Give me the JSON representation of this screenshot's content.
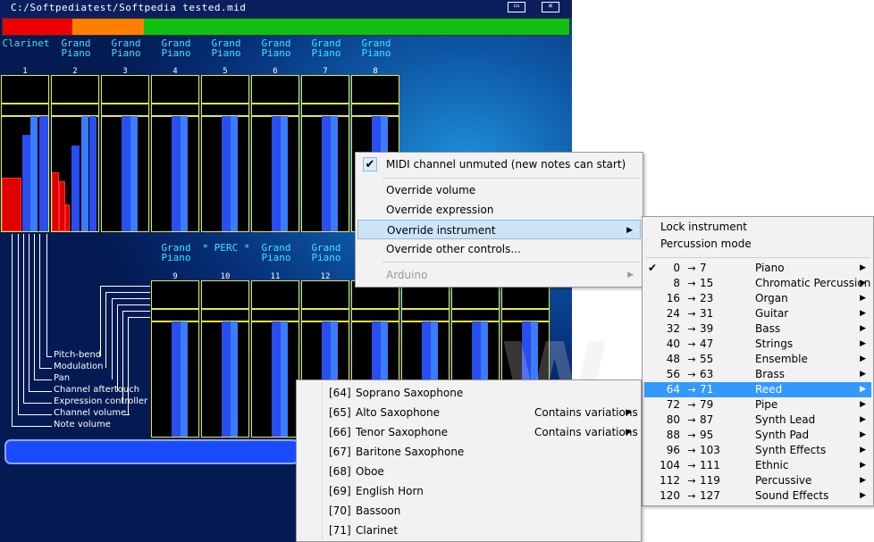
{
  "window": {
    "title": "C:/Softpediatest/Softpedia tested.mid",
    "minimize_glyph": "▭",
    "close_glyph": "✕"
  },
  "progress_colors": {
    "red": "#ee0000",
    "orange": "#ff8000",
    "green": "#10c010"
  },
  "top_instruments": [
    {
      "line1": "Clarinet",
      "line2": ""
    },
    {
      "line1": "Grand",
      "line2": "Piano"
    },
    {
      "line1": "Grand",
      "line2": "Piano"
    },
    {
      "line1": "Grand",
      "line2": "Piano"
    },
    {
      "line1": "Grand",
      "line2": "Piano"
    },
    {
      "line1": "Grand",
      "line2": "Piano"
    },
    {
      "line1": "Grand",
      "line2": "Piano"
    },
    {
      "line1": "Grand",
      "line2": "Piano"
    }
  ],
  "top_channels": [
    "1",
    "2",
    "3",
    "4",
    "5",
    "6",
    "7",
    "8"
  ],
  "bottom_instruments": [
    {
      "line1": "Grand",
      "line2": "Piano"
    },
    {
      "line1": "* PERC *",
      "line2": ""
    },
    {
      "line1": "Grand",
      "line2": "Piano"
    },
    {
      "line1": "Grand",
      "line2": "Piano"
    }
  ],
  "bottom_channels": [
    "9",
    "10",
    "11",
    "12"
  ],
  "legend": [
    "Pitch-bend",
    "Modulation",
    "Pan",
    "Channel aftertouch",
    "Expression controller",
    "Channel volume",
    "Note volume"
  ],
  "watermark": "W",
  "context_menu": {
    "unmuted": "MIDI channel unmuted (new notes can start)",
    "check_glyph": "✔",
    "override_volume": "Override volume",
    "override_expression": "Override expression",
    "override_instrument": "Override instrument",
    "override_other": "Override other controls...",
    "arduino": "Arduino",
    "arrow": "▶"
  },
  "instrument_menu": {
    "lock": "Lock instrument",
    "percussion": "Percussion mode",
    "arrow_glyph": "→",
    "groups": [
      {
        "from": "0",
        "to": "7",
        "name": "Piano"
      },
      {
        "from": "8",
        "to": "15",
        "name": "Chromatic Percussion"
      },
      {
        "from": "16",
        "to": "23",
        "name": "Organ"
      },
      {
        "from": "24",
        "to": "31",
        "name": "Guitar"
      },
      {
        "from": "32",
        "to": "39",
        "name": "Bass"
      },
      {
        "from": "40",
        "to": "47",
        "name": "Strings"
      },
      {
        "from": "48",
        "to": "55",
        "name": "Ensemble"
      },
      {
        "from": "56",
        "to": "63",
        "name": "Brass"
      },
      {
        "from": "64",
        "to": "71",
        "name": "Reed"
      },
      {
        "from": "72",
        "to": "79",
        "name": "Pipe"
      },
      {
        "from": "80",
        "to": "87",
        "name": "Synth Lead"
      },
      {
        "from": "88",
        "to": "95",
        "name": "Synth Pad"
      },
      {
        "from": "96",
        "to": "103",
        "name": "Synth Effects"
      },
      {
        "from": "104",
        "to": "111",
        "name": "Ethnic"
      },
      {
        "from": "112",
        "to": "119",
        "name": "Percussive"
      },
      {
        "from": "120",
        "to": "127",
        "name": "Sound Effects"
      }
    ]
  },
  "reed_menu": {
    "items": [
      {
        "program": "[64]",
        "name": "Soprano Saxophone",
        "variations": ""
      },
      {
        "program": "[65]",
        "name": "Alto Saxophone",
        "variations": "Contains variations"
      },
      {
        "program": "[66]",
        "name": "Tenor Saxophone",
        "variations": "Contains variations"
      },
      {
        "program": "[67]",
        "name": "Baritone Saxophone",
        "variations": ""
      },
      {
        "program": "[68]",
        "name": "Oboe",
        "variations": ""
      },
      {
        "program": "[69]",
        "name": "English Horn",
        "variations": ""
      },
      {
        "program": "[70]",
        "name": "Bassoon",
        "variations": ""
      },
      {
        "program": "[71]",
        "name": "Clarinet",
        "variations": ""
      }
    ]
  }
}
